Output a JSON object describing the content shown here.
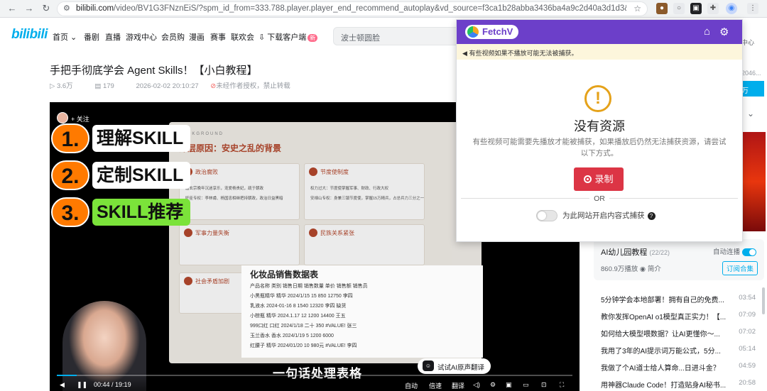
{
  "browser": {
    "url_host": "bilibili.com",
    "url_rest": "/video/BV1G3FNznEiS/?spm_id_from=333.788.player.player_end_recommend_autoplay&vd_source=f3ca1b28abba3436ba4a9c2d40a3d1d3&trackid=web_r..."
  },
  "header": {
    "logo": "bilibili",
    "nav": [
      "首页",
      "番剧",
      "直播",
      "游戏中心",
      "会员购",
      "漫画",
      "赛事",
      "联欢会"
    ],
    "download": "下载客户端",
    "download_badge": "新",
    "search_placeholder": "波士顿圆脸"
  },
  "video": {
    "title": "手把手彻底学会 Agent Skills！【小白教程】",
    "views": "3.6万",
    "danmaku": "179",
    "date": "2026-02-02 20:10:27",
    "rights": "未经作者授权，禁止转载",
    "follow": "+ 关注",
    "skills": [
      {
        "num": "1.",
        "text": "理解SKILL"
      },
      {
        "num": "2.",
        "text": "定制SKILL"
      },
      {
        "num": "3.",
        "text": "SKILL推荐"
      }
    ],
    "slide_bk": "BACKGROUND",
    "slide_heading": "深层原因：安史之乱的背景",
    "cards": [
      {
        "title": "政治腐败",
        "lines": [
          "唐玄宗晚年沉迷享乐，宠爱杨贵妃，疏于朝政",
          "奸臣专权：李林甫、杨国忠相继把持朝政，政治日益黑暗"
        ]
      },
      {
        "title": "节度使制度",
        "lines": [
          "权力过大：节度使掌握军事、财政、行政大权",
          "安禄山专权：身兼三镇节度使，掌握15万精兵，占总兵力三分之一"
        ]
      },
      {
        "title": "军事力量失衡",
        "lines": []
      },
      {
        "title": "民族关系紧张",
        "lines": []
      },
      {
        "title": "社会矛盾加剧",
        "lines": []
      }
    ],
    "sheet_title": "化妆品销售数据表",
    "sheet_rows": [
      "产品名称    类别    销售日期    销售数量    单价    销售额    销售员",
      "小黑瓶精华   精华    2024/1/15     15     850     12750   李四",
      "           乳液水   2024-01-16     8     1540    12320   李四   缺货",
      "小棕瓶     精华    2024.1.17     12     1200    14400   王五",
      "999口红    口红    2024/1/18    二十       350   #VALUE!  张三",
      "玉兰香水    香水    2024/1/19     5     1200     6000",
      "红腰子     精华    2024/01/20    10     980元    #VALUE!  李四"
    ],
    "subtitle": "一句话处理表格",
    "ai_translate": "试试AI原声翻译",
    "progress": 0.0382,
    "time_current": "00:44",
    "time_total": "19:19",
    "controls": [
      "自动",
      "倍速",
      "翻译"
    ]
  },
  "fetchv": {
    "name": "FetchV",
    "warning": "有些视频如果不播放可能无法被捕获。",
    "no_resource": "没有资源",
    "description": "有些视频可能需要先播放才能被捕获，如果播放后仍然无法捕获资源，请尝试以下方式。",
    "record": "录制",
    "or": "OR",
    "sniff_label": "为此网站开启内容式捕获",
    "help": "?",
    "colors": {
      "header": "#6c3fc9",
      "record": "#dc3545",
      "warn_bg": "#fdf6dc"
    }
  },
  "sidebar": {
    "peek_date": "2046...",
    "peek_btn": "万",
    "peek_center": "中心",
    "collection_title": "AI幼儿园教程",
    "collection_count": "(22/22)",
    "autoplay": "自动连播",
    "plays": "860.9万播放",
    "intro": "简介",
    "subscribe": "订阅合集",
    "playlist": [
      {
        "name": "5分钟学会本地部署！拥有自己的免费...",
        "dur": "03:54"
      },
      {
        "name": "教你发挥OpenAI o1模型真正实力！【...",
        "dur": "07:09"
      },
      {
        "name": "如何给大模型喂数据？让AI更懂你～...",
        "dur": "07:02"
      },
      {
        "name": "我用了3年的AI提示词万能公式，5分...",
        "dur": "05:14"
      },
      {
        "name": "我做了个AI道士给人算命...日进斗金？",
        "dur": "04:59"
      },
      {
        "name": "用神器Claude Code！打造贴身AI秘书...",
        "dur": "20:58"
      }
    ]
  }
}
